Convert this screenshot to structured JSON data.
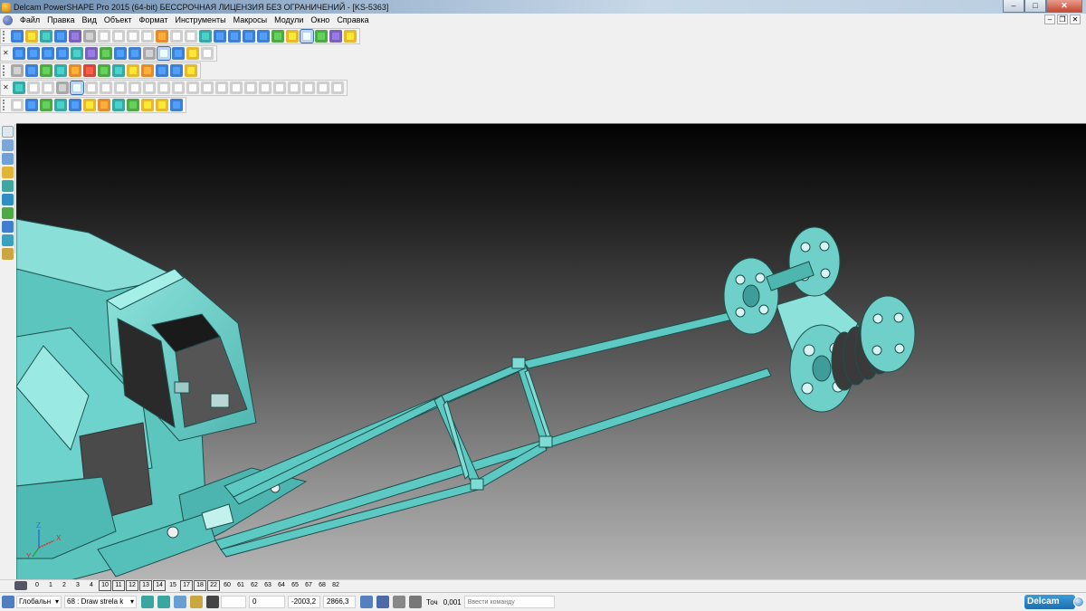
{
  "window": {
    "title": "Delcam PowerSHAPE Pro 2015 (64-bit) БЕССРОЧНАЯ ЛИЦЕНЗИЯ БЕЗ ОГРАНИЧЕНИЙ - [KS-5363]",
    "minimize": "–",
    "maximize": "□",
    "close": "✕"
  },
  "menu": {
    "items": [
      "Файл",
      "Правка",
      "Вид",
      "Объект",
      "Формат",
      "Инструменты",
      "Макросы",
      "Модули",
      "Окно",
      "Справка"
    ],
    "mdi_minimize": "–",
    "mdi_restore": "❐",
    "mdi_close": "✕"
  },
  "levels": {
    "items": [
      {
        "num": "0",
        "boxed": false
      },
      {
        "num": "1",
        "boxed": false
      },
      {
        "num": "2",
        "boxed": false
      },
      {
        "num": "3",
        "boxed": false
      },
      {
        "num": "4",
        "boxed": false
      },
      {
        "num": "10",
        "boxed": true
      },
      {
        "num": "11",
        "boxed": true
      },
      {
        "num": "12",
        "boxed": true
      },
      {
        "num": "13",
        "boxed": true
      },
      {
        "num": "14",
        "boxed": true
      },
      {
        "num": "15",
        "boxed": false
      },
      {
        "num": "17",
        "boxed": true
      },
      {
        "num": "18",
        "boxed": true
      },
      {
        "num": "22",
        "boxed": true
      },
      {
        "num": "60",
        "boxed": false
      },
      {
        "num": "61",
        "boxed": false
      },
      {
        "num": "62",
        "boxed": false
      },
      {
        "num": "63",
        "boxed": false
      },
      {
        "num": "64",
        "boxed": false
      },
      {
        "num": "65",
        "boxed": false
      },
      {
        "num": "67",
        "boxed": false
      },
      {
        "num": "68",
        "boxed": false
      },
      {
        "num": "82",
        "boxed": false
      }
    ]
  },
  "status": {
    "workplane": "Глобальн",
    "level": "68 : Draw strela k",
    "value_0": "0",
    "coord_x": "-2003,2",
    "coord_y": "2866,3",
    "tolerance_label": "Точ",
    "tolerance": "0,001",
    "command_placeholder": "Ввести команду",
    "brand": "Delcam"
  },
  "axes": {
    "x": "X",
    "y": "Y",
    "z": "Z"
  },
  "colors": {
    "model": "#6fd3cc",
    "model_dark": "#3f9c98",
    "edge": "#1e4f4d"
  }
}
